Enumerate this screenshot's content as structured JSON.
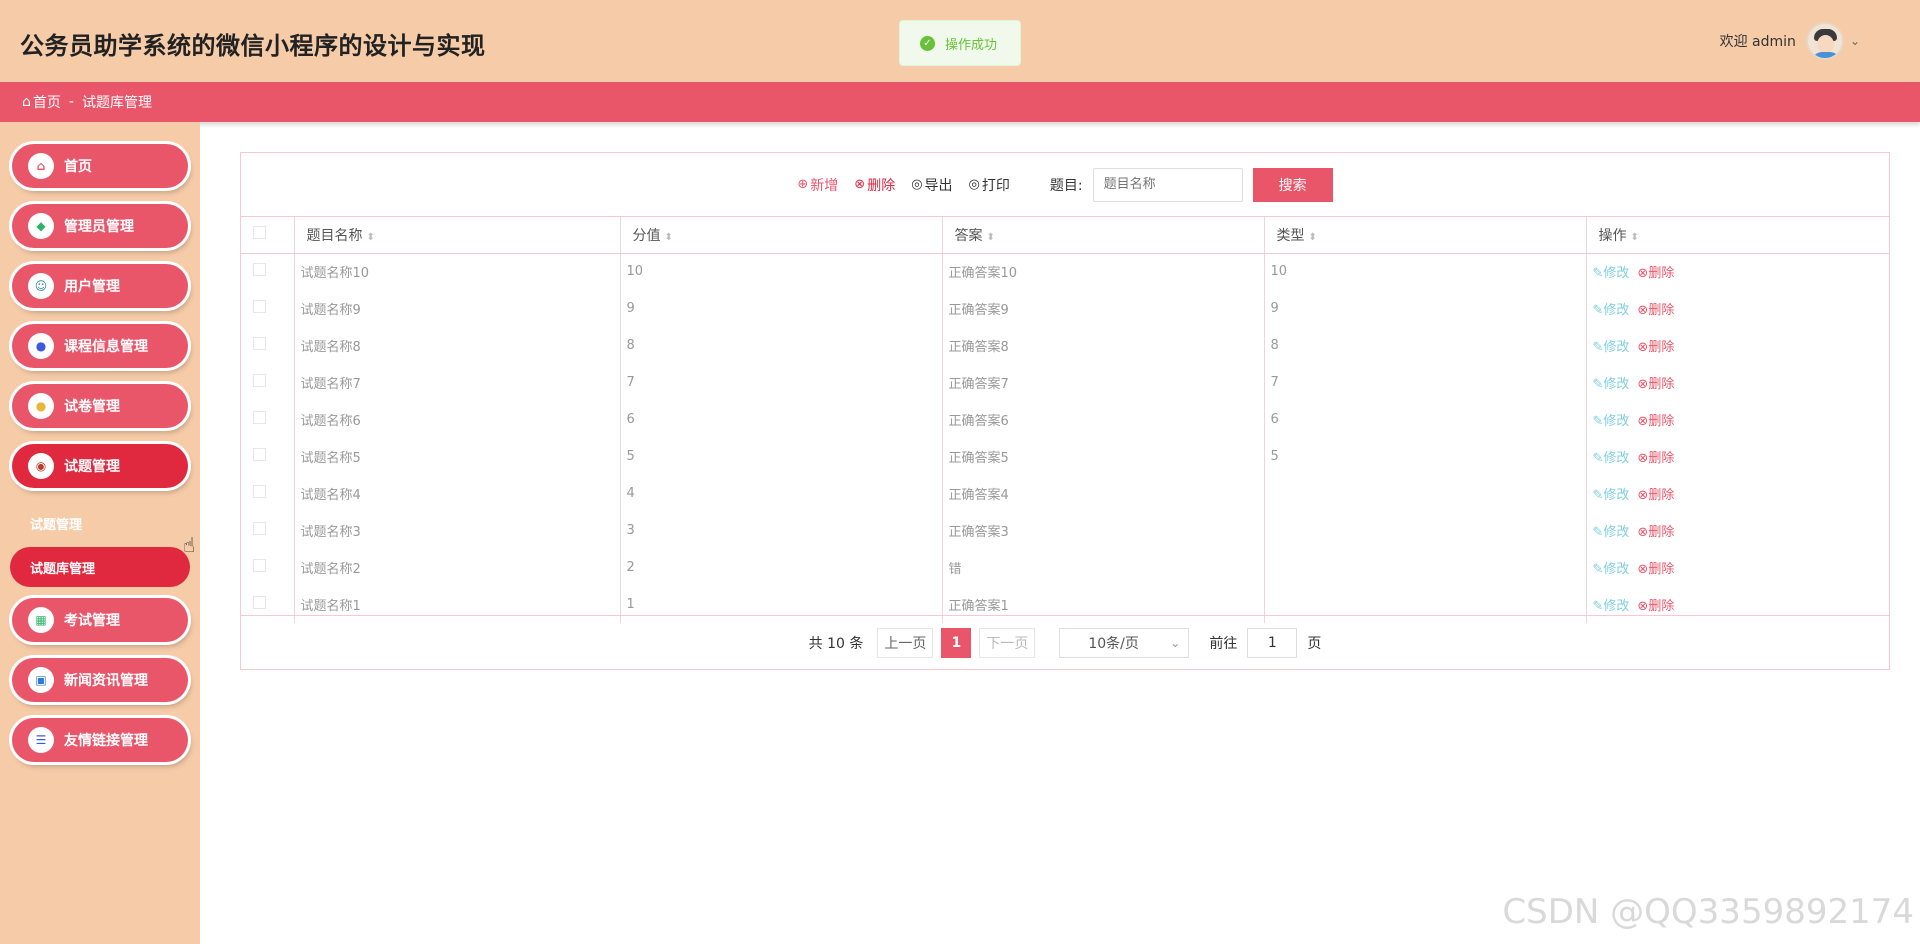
{
  "header": {
    "title": "公务员助学系统的微信小程序的设计与实现",
    "toast": "操作成功",
    "welcome": "欢迎 admin"
  },
  "breadcrumb": {
    "home": "首页",
    "separator": "-",
    "current": "试题库管理"
  },
  "sidebar": {
    "items": [
      {
        "label": "首页",
        "icon": "home-icon"
      },
      {
        "label": "管理员管理",
        "icon": "admin-icon"
      },
      {
        "label": "用户管理",
        "icon": "user-icon"
      },
      {
        "label": "课程信息管理",
        "icon": "course-icon"
      },
      {
        "label": "试卷管理",
        "icon": "paper-icon"
      },
      {
        "label": "试题管理",
        "icon": "question-icon"
      },
      {
        "label": "考试管理",
        "icon": "exam-icon"
      },
      {
        "label": "新闻资讯管理",
        "icon": "news-icon"
      },
      {
        "label": "友情链接管理",
        "icon": "link-icon"
      }
    ],
    "submenu": {
      "plain": "试题管理",
      "active": "试题库管理"
    }
  },
  "toolbar": {
    "add": "新增",
    "delete": "删除",
    "export": "导出",
    "print": "打印",
    "search_label": "题目:",
    "search_placeholder": "题目名称",
    "search_button": "搜索"
  },
  "table": {
    "headers": [
      "题目名称",
      "分值",
      "答案",
      "类型",
      "操作"
    ],
    "rows": [
      {
        "name": "试题名称10",
        "score": "10",
        "answer": "正确答案10",
        "type": "10"
      },
      {
        "name": "试题名称9",
        "score": "9",
        "answer": "正确答案9",
        "type": "9"
      },
      {
        "name": "试题名称8",
        "score": "8",
        "answer": "正确答案8",
        "type": "8"
      },
      {
        "name": "试题名称7",
        "score": "7",
        "answer": "正确答案7",
        "type": "7"
      },
      {
        "name": "试题名称6",
        "score": "6",
        "answer": "正确答案6",
        "type": "6"
      },
      {
        "name": "试题名称5",
        "score": "5",
        "answer": "正确答案5",
        "type": "5"
      },
      {
        "name": "试题名称4",
        "score": "4",
        "answer": "正确答案4",
        "type": ""
      },
      {
        "name": "试题名称3",
        "score": "3",
        "answer": "正确答案3",
        "type": ""
      },
      {
        "name": "试题名称2",
        "score": "2",
        "answer": "错",
        "type": ""
      },
      {
        "name": "试题名称1",
        "score": "1",
        "answer": "正确答案1",
        "type": ""
      }
    ],
    "edit_label": "修改",
    "delete_label": "删除"
  },
  "pager": {
    "total": "共 10 条",
    "prev": "上一页",
    "current": "1",
    "next": "下一页",
    "page_size": "10条/页",
    "goto_label": "前往",
    "goto_value": "1",
    "page_suffix": "页"
  },
  "watermark": "CSDN @QQ3359892174",
  "colors": {
    "header": "#f6cba8",
    "accent": "#e9566a",
    "active": "#e0283f"
  }
}
